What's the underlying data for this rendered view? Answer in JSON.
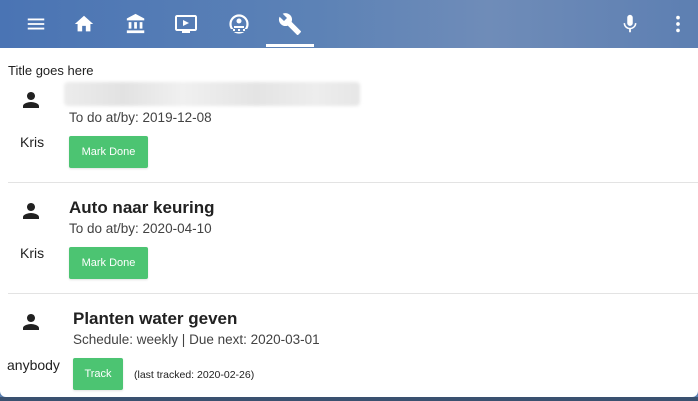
{
  "toolbar": {
    "menu_icon": "menu-icon",
    "tabs": [
      {
        "icon": "home-icon"
      },
      {
        "icon": "bank-icon"
      },
      {
        "icon": "tv-play-icon"
      },
      {
        "icon": "robot-vacuum-icon"
      },
      {
        "icon": "wrench-icon",
        "active": true
      }
    ],
    "mic_icon": "microphone-icon",
    "more_icon": "dots-vertical-icon"
  },
  "card": {
    "title": "Title goes here",
    "items": [
      {
        "name": "",
        "name_blurred": true,
        "meta": "To do at/by: 2019-12-08",
        "assignee": "Kris",
        "button_label": "Mark Done"
      },
      {
        "name": "Auto naar keuring",
        "meta": "To do at/by: 2020-04-10",
        "assignee": "Kris",
        "button_label": "Mark Done"
      },
      {
        "name": "Planten water geven",
        "meta": "Schedule: weekly | Due next: 2020-03-01",
        "assignee": "anybody",
        "button_label": "Track",
        "last_tracked": "(last tracked: 2020-02-26)"
      }
    ]
  },
  "colors": {
    "accent_button": "#4cc472",
    "toolbar": "#5c82b6"
  }
}
